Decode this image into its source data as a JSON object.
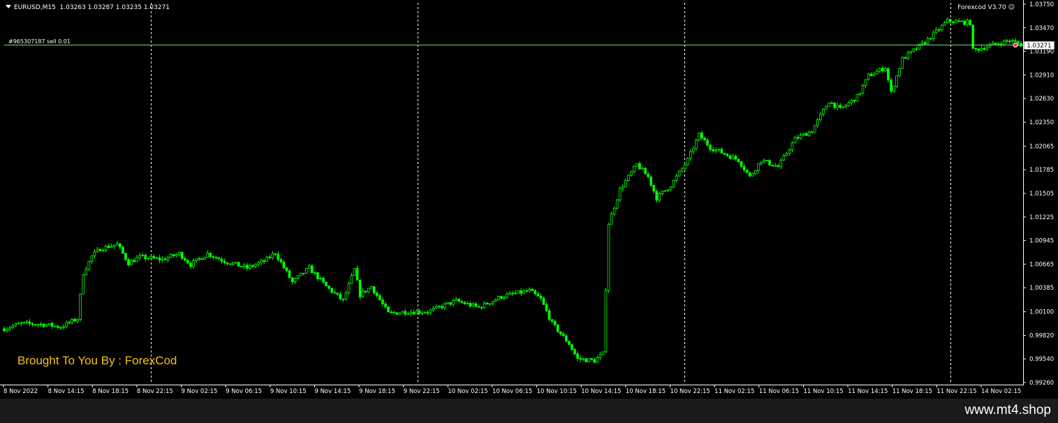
{
  "header": {
    "symbol": "EURUSD,M15",
    "ohlc": "1.03263 1.03287 1.03235 1.03271"
  },
  "expert": {
    "label": "Forexcod V3.70",
    "icon": "smiley-icon"
  },
  "order_line": {
    "label": "#965307187 sell 0.01",
    "price": 1.03271
  },
  "current_price_label": "1.03271",
  "watermark": "Brought To You By : ForexCod",
  "footer": {
    "site": "www.mt4.shop"
  },
  "colors": {
    "background": "#000000",
    "candle": "#00ff00",
    "order_line": "#7fdc7f",
    "watermark": "#f2c314",
    "grid_separator": "#ffffff"
  },
  "chart_data": {
    "type": "candlestick",
    "symbol": "EURUSD",
    "timeframe": "M15",
    "ylim": [
      0.9926,
      1.0375
    ],
    "y_ticks": [
      "1.03750",
      "1.03470",
      "1.03190",
      "1.02910",
      "1.02630",
      "1.02350",
      "1.02065",
      "1.01785",
      "1.01505",
      "1.01225",
      "1.00945",
      "1.00665",
      "1.00385",
      "1.00100",
      "0.99820",
      "0.99540",
      "0.99260"
    ],
    "x_ticks": [
      "8 Nov 2022",
      "8 Nov 14:15",
      "8 Nov 18:15",
      "8 Nov 22:15",
      "9 Nov 02:15",
      "9 Nov 06:15",
      "9 Nov 10:15",
      "9 Nov 14:15",
      "9 Nov 18:15",
      "9 Nov 22:15",
      "10 Nov 02:15",
      "10 Nov 06:15",
      "10 Nov 10:15",
      "10 Nov 14:15",
      "10 Nov 18:15",
      "10 Nov 22:15",
      "11 Nov 02:15",
      "11 Nov 06:15",
      "11 Nov 10:15",
      "11 Nov 14:15",
      "11 Nov 18:15",
      "11 Nov 22:15",
      "14 Nov 02:15"
    ],
    "day_separators": [
      "8 Nov 22:15",
      "9 Nov 22:15",
      "10 Nov 22:15",
      "11 Nov 22:15"
    ],
    "close_anchors": [
      {
        "t": 0,
        "v": 0.999
      },
      {
        "t": 6,
        "v": 0.9996
      },
      {
        "t": 14,
        "v": 0.9995
      },
      {
        "t": 20,
        "v": 0.9992
      },
      {
        "t": 26,
        "v": 1.0002
      },
      {
        "t": 28,
        "v": 1.0056
      },
      {
        "t": 31,
        "v": 1.0076
      },
      {
        "t": 34,
        "v": 1.0085
      },
      {
        "t": 40,
        "v": 1.009
      },
      {
        "t": 44,
        "v": 1.0068
      },
      {
        "t": 48,
        "v": 1.0075
      },
      {
        "t": 56,
        "v": 1.0072
      },
      {
        "t": 62,
        "v": 1.0079
      },
      {
        "t": 66,
        "v": 1.0066
      },
      {
        "t": 72,
        "v": 1.0079
      },
      {
        "t": 78,
        "v": 1.007
      },
      {
        "t": 86,
        "v": 1.0062
      },
      {
        "t": 92,
        "v": 1.007
      },
      {
        "t": 96,
        "v": 1.008
      },
      {
        "t": 102,
        "v": 1.0045
      },
      {
        "t": 108,
        "v": 1.0062
      },
      {
        "t": 114,
        "v": 1.004
      },
      {
        "t": 120,
        "v": 1.0023
      },
      {
        "t": 124,
        "v": 1.006
      },
      {
        "t": 126,
        "v": 1.003
      },
      {
        "t": 130,
        "v": 1.004
      },
      {
        "t": 136,
        "v": 1.0008
      },
      {
        "t": 142,
        "v": 1.001
      },
      {
        "t": 150,
        "v": 1.001
      },
      {
        "t": 160,
        "v": 1.0023
      },
      {
        "t": 168,
        "v": 1.0015
      },
      {
        "t": 176,
        "v": 1.0028
      },
      {
        "t": 186,
        "v": 1.0035
      },
      {
        "t": 190,
        "v": 1.0025
      },
      {
        "t": 194,
        "v": 0.9996
      },
      {
        "t": 200,
        "v": 0.9972
      },
      {
        "t": 203,
        "v": 0.9954
      },
      {
        "t": 209,
        "v": 0.9952
      },
      {
        "t": 212,
        "v": 0.996
      },
      {
        "t": 214,
        "v": 1.0115
      },
      {
        "t": 218,
        "v": 1.0155
      },
      {
        "t": 224,
        "v": 1.0185
      },
      {
        "t": 228,
        "v": 1.017
      },
      {
        "t": 231,
        "v": 1.0145
      },
      {
        "t": 236,
        "v": 1.016
      },
      {
        "t": 242,
        "v": 1.019
      },
      {
        "t": 246,
        "v": 1.022
      },
      {
        "t": 250,
        "v": 1.0205
      },
      {
        "t": 260,
        "v": 1.019
      },
      {
        "t": 264,
        "v": 1.017
      },
      {
        "t": 268,
        "v": 1.019
      },
      {
        "t": 274,
        "v": 1.0182
      },
      {
        "t": 280,
        "v": 1.0215
      },
      {
        "t": 286,
        "v": 1.0225
      },
      {
        "t": 292,
        "v": 1.026
      },
      {
        "t": 296,
        "v": 1.025
      },
      {
        "t": 302,
        "v": 1.0265
      },
      {
        "t": 306,
        "v": 1.029
      },
      {
        "t": 312,
        "v": 1.03
      },
      {
        "t": 314,
        "v": 1.027
      },
      {
        "t": 318,
        "v": 1.031
      },
      {
        "t": 326,
        "v": 1.033
      },
      {
        "t": 334,
        "v": 1.0355
      },
      {
        "t": 342,
        "v": 1.0353
      },
      {
        "t": 343,
        "v": 1.032
      },
      {
        "t": 348,
        "v": 1.0325
      },
      {
        "t": 356,
        "v": 1.0332
      },
      {
        "t": 360,
        "v": 1.03271
      }
    ]
  }
}
